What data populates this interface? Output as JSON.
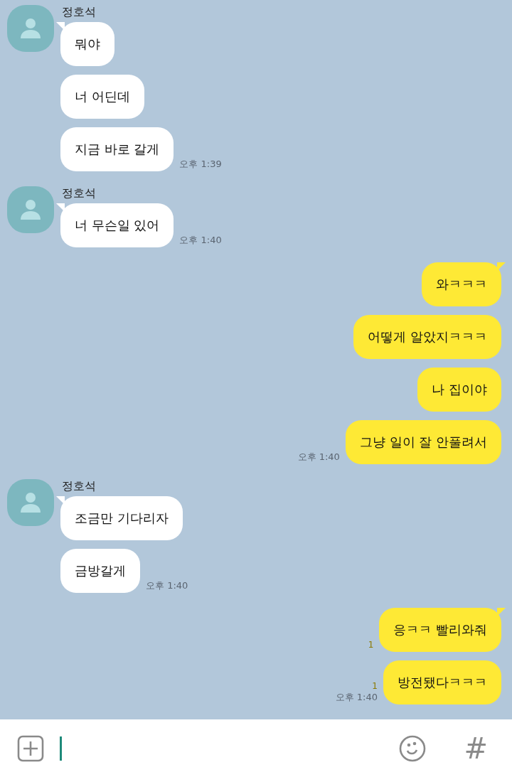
{
  "groups": [
    {
      "kind": "received",
      "sender": "정호석",
      "messages": [
        {
          "text": "뭐야"
        },
        {
          "text": "너 어딘데"
        },
        {
          "text": "지금 바로 갈게",
          "time": "오후 1:39"
        }
      ]
    },
    {
      "kind": "received",
      "sender": "정호석",
      "messages": [
        {
          "text": "너 무슨일 있어",
          "time": "오후 1:40"
        }
      ]
    },
    {
      "kind": "sent",
      "messages": [
        {
          "text": "와ㅋㅋㅋ"
        },
        {
          "text": "어떻게 알았지ㅋㅋㅋ"
        },
        {
          "text": "나 집이야"
        },
        {
          "text": "그냥 일이 잘 안풀려서",
          "time": "오후 1:40"
        }
      ]
    },
    {
      "kind": "received",
      "sender": "정호석",
      "messages": [
        {
          "text": "조금만 기다리자"
        },
        {
          "text": "금방갈게",
          "time": "오후 1:40"
        }
      ]
    },
    {
      "kind": "sent",
      "messages": [
        {
          "text": "응ㅋㅋ 빨리와줘",
          "unread": "1"
        },
        {
          "text": "방전됐다ㅋㅋㅋ",
          "unread": "1",
          "time": "오후 1:40"
        }
      ]
    }
  ],
  "composer": {
    "hashtag_button": "#"
  }
}
